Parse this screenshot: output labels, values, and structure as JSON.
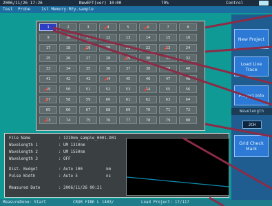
{
  "top_bar": {
    "datetime": "2006/11/26 17:26",
    "title": "NewEFT(ver) 10:00",
    "battery_level": "79%",
    "control": "Control"
  },
  "menu": {
    "items": [
      "Test",
      "Probe",
      "1st Memory:REy.sample"
    ]
  },
  "grid": {
    "cells": [
      "1",
      "2",
      "3",
      "4",
      "5",
      "6",
      "7",
      "8",
      "9",
      "10",
      "11",
      "12",
      "13",
      "14",
      "15",
      "16",
      "17",
      "18",
      "19",
      "20",
      "21",
      "22",
      "23",
      "24",
      "25",
      "26",
      "27",
      "28",
      "29",
      "30",
      "31",
      "32",
      "33",
      "34",
      "35",
      "36",
      "37",
      "38",
      "39",
      "40",
      "41",
      "42",
      "43",
      "44",
      "45",
      "46",
      "47",
      "48",
      "49",
      "50",
      "51",
      "52",
      "53",
      "54",
      "55",
      "56",
      "57",
      "58",
      "59",
      "60",
      "61",
      "62",
      "63",
      "64",
      "65",
      "66",
      "67",
      "68",
      "69",
      "70",
      "71",
      "72",
      "73",
      "74",
      "75",
      "76",
      "77",
      "78",
      "79",
      "80"
    ],
    "selected_cell": "1",
    "checked_cells": [
      "4",
      "6",
      "19",
      "23",
      "29",
      "44",
      "49",
      "54",
      "57",
      "73"
    ]
  },
  "info": {
    "file_name_label": "File Name",
    "file_name_value": ": 1210nm_sample_0001.D01",
    "wl1_label": "Wavelength 1",
    "wl1_value": ": UM 1310nm",
    "wl2_label": "Wavelength 2",
    "wl2_value": ": UM 1550nm",
    "wl3_label": "Wavelength 3",
    "wl3_value": ": OFF",
    "budget_label": "Dist. Budget",
    "budget_value": ": Auto 100",
    "budget_unit": "km",
    "pulse_label": "Pulse Width",
    "pulse_value": ": Auto 5",
    "pulse_unit": "ns",
    "measured_label": "Measured Date",
    "measured_value": ": 2006/11/26 00:21"
  },
  "status_bar": {
    "left": "MeasureDone: Start",
    "middle": "CROR FIBE L 1403/",
    "right": "Load Project: 17/117"
  },
  "side_panel": {
    "new_project": "New Project",
    "load_live_trace": "Load Live Trace",
    "project_info": "Project Info",
    "wavelength_label": "Wavelength",
    "wavelength_value": "2CH",
    "grid_check_mark": "Grid Check Mark"
  },
  "colors": {
    "screen_bg": "#0f9a95",
    "grid_cell": "#5e6a6c",
    "selected_cell": "#2e3ec2",
    "check_mark": "#e7443c",
    "callout_line": "#8c2b46",
    "side_button": "#2c7ad5"
  }
}
